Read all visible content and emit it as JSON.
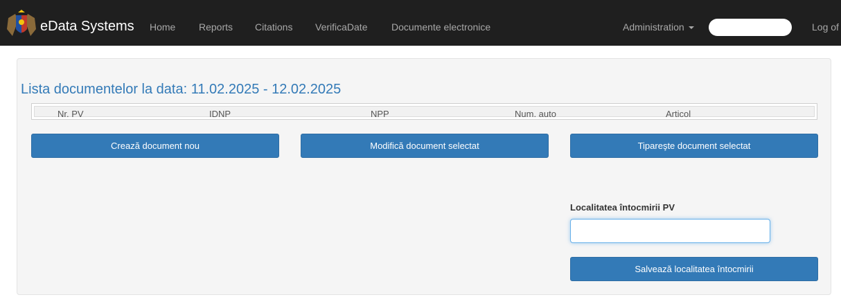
{
  "navbar": {
    "brand": "eData Systems",
    "links": [
      "Home",
      "Reports",
      "Citations",
      "VerificaDate",
      "Documente electronice"
    ],
    "admin_label": "Administration",
    "logoff": "Log of"
  },
  "main": {
    "title": "Lista documentelor la data: 11.02.2025 - 12.02.2025",
    "table_columns": [
      "Nr. PV",
      "IDNP",
      "NPP",
      "Num. auto",
      "Articol"
    ],
    "buttons": {
      "create": "Crează document nou",
      "modify": "Modifică document selectat",
      "print": "Tipareşte document selectat",
      "save": "Salvează localitatea întocmirii"
    },
    "location_field": {
      "label": "Localitatea întocmirii PV",
      "value": ""
    }
  },
  "colors": {
    "navbar_bg": "#1f1f1f",
    "primary": "#337ab7",
    "panel_bg": "#f5f5f5"
  }
}
